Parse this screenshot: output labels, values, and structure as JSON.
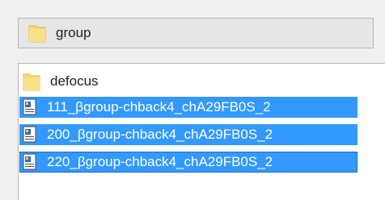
{
  "path_box": {
    "current_folder": "group",
    "icon": "folder-icon"
  },
  "list": {
    "items": [
      {
        "label": "defocus",
        "type": "folder",
        "icon": "folder-icon",
        "selected": false
      },
      {
        "label": "111_βgroup-chback4_chA29FB0S_2",
        "type": "file",
        "icon": "document-image-icon",
        "selected": true
      },
      {
        "label": "200_βgroup-chback4_chA29FB0S_2",
        "type": "file",
        "icon": "document-image-icon",
        "selected": true
      },
      {
        "label": "220_βgroup-chback4_chA29FB0S_2",
        "type": "file",
        "icon": "document-image-icon",
        "selected": true
      }
    ]
  },
  "colors": {
    "selection": "#3399ff",
    "folder": "#f8d775",
    "window_bg": "#f0f0f0"
  }
}
